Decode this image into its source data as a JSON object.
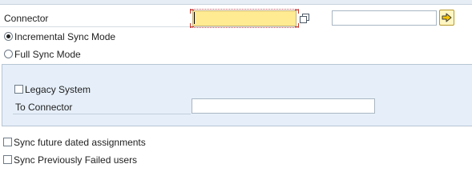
{
  "connector": {
    "label": "Connector",
    "value": "",
    "secondary_value": ""
  },
  "sync_mode": {
    "options": [
      {
        "label": "Incremental Sync Mode",
        "selected": true
      },
      {
        "label": "Full Sync Mode",
        "selected": false
      }
    ]
  },
  "legacy_group": {
    "legacy_system_label": "Legacy System",
    "legacy_system_checked": false,
    "to_connector_label": "To Connector",
    "to_connector_value": ""
  },
  "options": {
    "future_dated_label": "Sync future dated assignments",
    "future_dated_checked": false,
    "failed_users_label": "Sync Previously Failed users",
    "failed_users_checked": false
  },
  "icons": {
    "copy": "copy-icon",
    "execute": "arrow-right-icon"
  },
  "colors": {
    "focused_field_bg": "#ffeb91",
    "group_panel_bg": "#e6eff9",
    "arrow_button_bg": "#fff6c2",
    "arrow_fill": "#f5c400",
    "focus_corner": "#c0392b"
  }
}
